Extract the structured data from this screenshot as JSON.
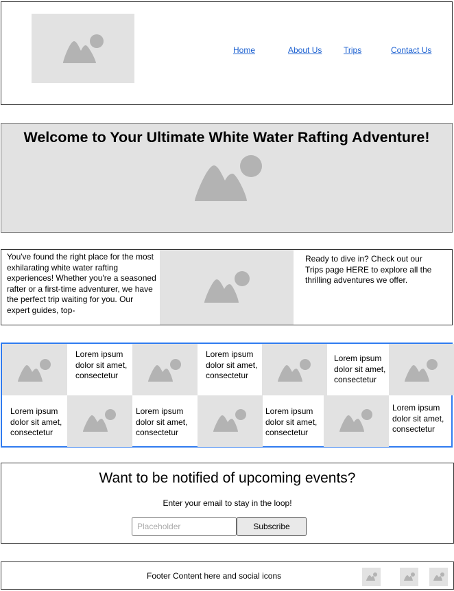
{
  "header": {
    "nav": {
      "home": "Home",
      "about": "About Us",
      "trips": "Trips",
      "contact": "Contact Us"
    }
  },
  "hero": {
    "title": "Welcome to Your Ultimate White Water Rafting Adventure!"
  },
  "intro": {
    "left_text": "You've found the right place for the most exhilarating white water rafting experiences! Whether you're a seasoned rafter or a first-time adventurer, we have the perfect trip waiting for you. Our expert guides, top-",
    "right_text": "Ready to dive in? Check out our Trips page HERE to explore all the thrilling adventures we offer."
  },
  "grid": {
    "cell_text": "Lorem ipsum dolor sit amet, consectetur"
  },
  "newsletter": {
    "title": "Want to be notified of upcoming events?",
    "subtitle": "Enter your email to stay in the loop!",
    "email_placeholder": "Placeholder",
    "subscribe_label": "Subscribe"
  },
  "footer": {
    "text": "Footer Content here and social icons"
  },
  "icons": {
    "placeholder": "image-placeholder-icon",
    "social": "social-icon"
  },
  "colors": {
    "link": "#1a5fd0",
    "grid_border": "#2f7bf0",
    "placeholder_bg": "#e2e2e2",
    "placeholder_glyph": "#b3b3b3"
  }
}
